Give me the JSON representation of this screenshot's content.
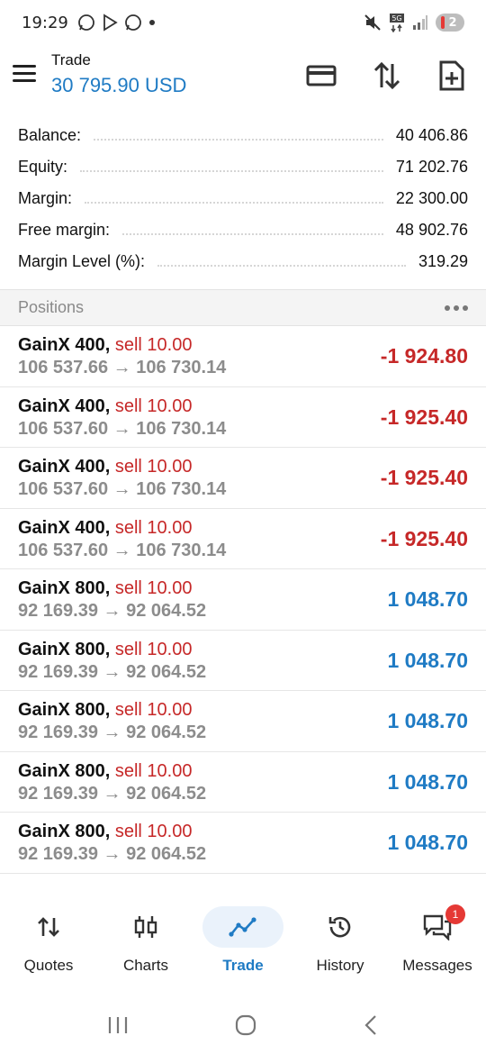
{
  "status_bar": {
    "time": "19:29",
    "battery": "2",
    "network": "5G"
  },
  "header": {
    "title": "Trade",
    "balance_display": "30 795.90 USD"
  },
  "summary": [
    {
      "label": "Balance:",
      "value": "40 406.86"
    },
    {
      "label": "Equity:",
      "value": "71 202.76"
    },
    {
      "label": "Margin:",
      "value": "22 300.00"
    },
    {
      "label": "Free margin:",
      "value": "48 902.76"
    },
    {
      "label": "Margin Level (%):",
      "value": "319.29"
    }
  ],
  "positions_header": {
    "title": "Positions"
  },
  "positions": [
    {
      "symbol": "GainX 400,",
      "side": "sell 10.00",
      "prices": "106 537.66 → 106 730.14",
      "profit": "-1 924.80",
      "direction": "neg"
    },
    {
      "symbol": "GainX 400,",
      "side": "sell 10.00",
      "prices": "106 537.60 → 106 730.14",
      "profit": "-1 925.40",
      "direction": "neg"
    },
    {
      "symbol": "GainX 400,",
      "side": "sell 10.00",
      "prices": "106 537.60 → 106 730.14",
      "profit": "-1 925.40",
      "direction": "neg"
    },
    {
      "symbol": "GainX 400,",
      "side": "sell 10.00",
      "prices": "106 537.60 → 106 730.14",
      "profit": "-1 925.40",
      "direction": "neg"
    },
    {
      "symbol": "GainX 800,",
      "side": "sell 10.00",
      "prices": "92 169.39 → 92 064.52",
      "profit": "1 048.70",
      "direction": "pos"
    },
    {
      "symbol": "GainX 800,",
      "side": "sell 10.00",
      "prices": "92 169.39 → 92 064.52",
      "profit": "1 048.70",
      "direction": "pos"
    },
    {
      "symbol": "GainX 800,",
      "side": "sell 10.00",
      "prices": "92 169.39 → 92 064.52",
      "profit": "1 048.70",
      "direction": "pos"
    },
    {
      "symbol": "GainX 800,",
      "side": "sell 10.00",
      "prices": "92 169.39 → 92 064.52",
      "profit": "1 048.70",
      "direction": "pos"
    },
    {
      "symbol": "GainX 800,",
      "side": "sell 10.00",
      "prices": "92 169.39 → 92 064.52",
      "profit": "1 048.70",
      "direction": "pos"
    }
  ],
  "bottom_nav": {
    "items": [
      {
        "label": "Quotes",
        "icon": "quotes-icon"
      },
      {
        "label": "Charts",
        "icon": "charts-icon"
      },
      {
        "label": "Trade",
        "icon": "trade-icon",
        "active": true
      },
      {
        "label": "History",
        "icon": "history-icon"
      },
      {
        "label": "Messages",
        "icon": "messages-icon",
        "badge": "1"
      }
    ]
  },
  "colors": {
    "accent": "#1f7bc4",
    "loss": "#c62828",
    "badge": "#e53935"
  }
}
